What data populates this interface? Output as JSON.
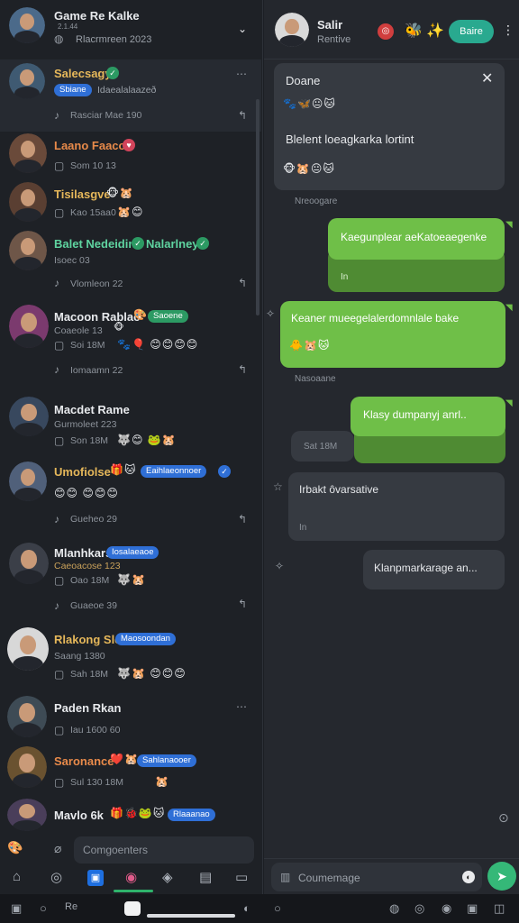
{
  "left_header": {
    "title": "Game Re Kalke",
    "subtitle": "Rlacrmreen 2023",
    "tagline": "2.1.44"
  },
  "chats": [
    {
      "name": "Salecsagy",
      "pill_blue": "Sbiane",
      "extra": "Idaealalaazeð",
      "meta": "Rasciar Mae 190"
    },
    {
      "name": "Laano Faacc",
      "meta": "Som 10 13"
    },
    {
      "name": "Tisilasgve",
      "meta": "Kao 15aa0"
    },
    {
      "name": "Balet Nedeidine",
      "name2": "Nalarlney",
      "sub": "Isoec 03",
      "meta": "Vlomleon 22"
    },
    {
      "name": "Macoon Rablac",
      "pill_green": "Saoene",
      "sub": "Coaeole 13",
      "meta": "Soi 18M",
      "meta2": "Iomaamn 22"
    },
    {
      "name": "Macdet Rame",
      "sub": "Gurmoleet 223",
      "meta": "Son 18M"
    },
    {
      "name": "Umofiolse",
      "pill_blue": "Eaihlaeonnoer",
      "meta": "Gueheo 29"
    },
    {
      "name": "Mlanhkars",
      "pill_blue": "Iosalaeaoe",
      "sub": "Caeoacose 123",
      "meta": "Oao 18M",
      "meta2": "Guaeoe 39"
    },
    {
      "name": "Rlakong Sle",
      "pill_blue": "Maosoondan",
      "sub": "Saang 1380",
      "meta": "Sah 18M"
    },
    {
      "name": "Paden Rkan",
      "meta": "Iau 1600 60"
    },
    {
      "name": "Saronance",
      "pill_blue": "Sahlanaooer",
      "meta": "Sul 130 18M"
    },
    {
      "name": "Mavlo 6k",
      "pill_blue": "Rlaaanao"
    }
  ],
  "left_compose": {
    "placeholder": "Comgoenters"
  },
  "right_header": {
    "name": "Salir",
    "status": "Rentive",
    "button": "Baire"
  },
  "messages": {
    "card_title": "Doane",
    "card_body": "Blelent loeagkarka lortint",
    "card_time": "Nreoogare",
    "out1": "Kaegunplear aeKatoeaegenke",
    "out1_meta": "In",
    "out2": "Keaner mueegelalerdomnlale bake",
    "out2_time": "Nasoaane",
    "out3": "Klasy dumpanyj anrl..",
    "out3_meta": "Sat 18M",
    "in1": "Irbakt ôvarsative",
    "in1_meta": "In",
    "in2": "Klanpmarkarage an..."
  },
  "right_compose": {
    "placeholder": "Coumemage"
  },
  "colors": {
    "accent_green": "#6fbf48",
    "teal_button": "#29a98f",
    "blue_pill": "#2f6fd6",
    "background": "#1c1f24"
  }
}
